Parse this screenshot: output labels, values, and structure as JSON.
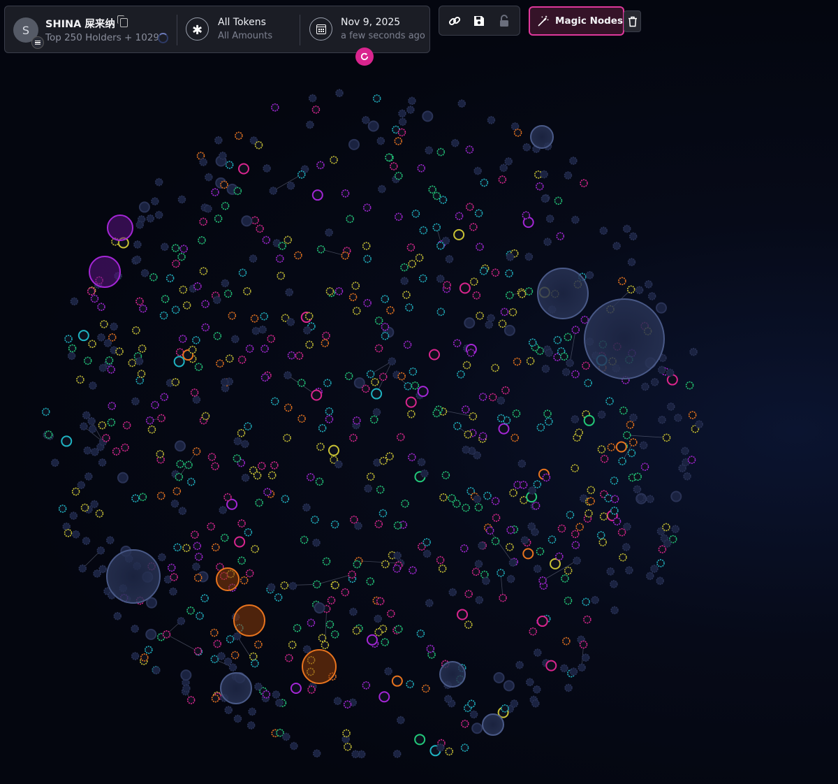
{
  "header": {
    "avatar_letter": "S",
    "token_name": "SHINA 屎来纳",
    "holders_label": "Top 250 Holders + 1029",
    "tokens_title": "All Tokens",
    "tokens_subtitle": "All Amounts",
    "date": "Nov 9, 2025",
    "date_relative": "a few seconds ago"
  },
  "toolbar": {
    "icons": [
      "link-icon",
      "save-icon",
      "unlock-icon"
    ],
    "magic_label": "Magic Nodes",
    "delete_icon": "trash-icon"
  },
  "colors": {
    "background": "#04060f",
    "accent": "#e0389c",
    "node_palette": {
      "green": "#22c97a",
      "yellow": "#c9c234",
      "magenta": "#d9258e",
      "purple": "#a426d6",
      "cyan": "#1fb3c2",
      "navy": "#2a3356",
      "orange": "#e8741e"
    }
  }
}
